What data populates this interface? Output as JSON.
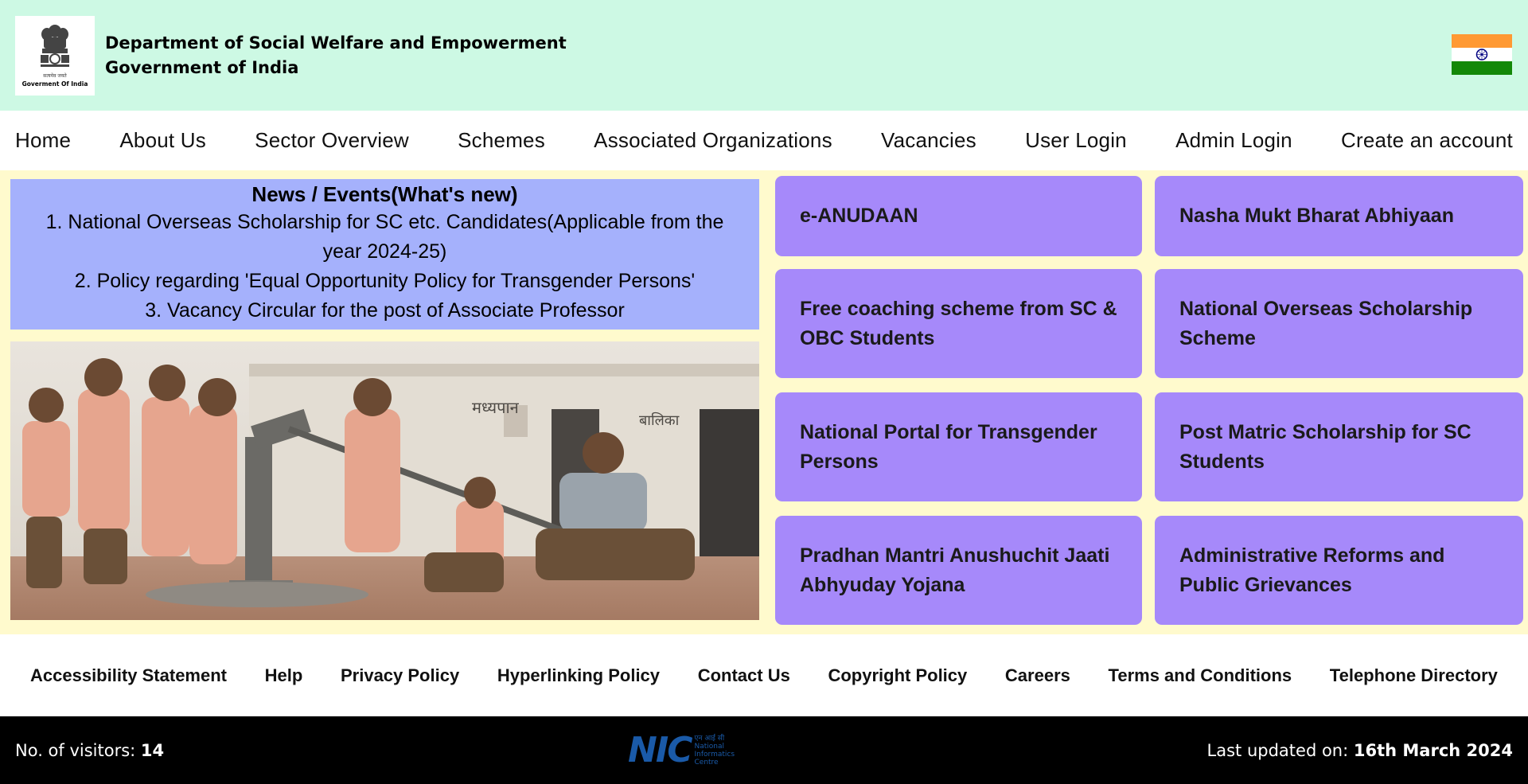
{
  "header": {
    "emblem_motto": "सत्यमेव जयते",
    "emblem_caption": "Goverment Of India",
    "department": "Department of Social Welfare and Empowerment",
    "government": "Government of India",
    "flag_colors": [
      "#ff9933",
      "#ffffff",
      "#138808"
    ]
  },
  "nav": {
    "items": [
      "Home",
      "About Us",
      "Sector Overview",
      "Schemes",
      "Associated Organizations",
      "Vacancies",
      "User Login",
      "Admin Login",
      "Create an account"
    ]
  },
  "news": {
    "title": "News / Events(What's new)",
    "items": [
      "1. National Overseas Scholarship for SC etc. Candidates(Applicable from the year 2024-25)",
      "2. Policy regarding 'Equal Opportunity Policy for Transgender Persons'",
      "3. Vacancy Circular for the post of Associate Professor"
    ]
  },
  "photo": {
    "wall_sign_left": "मध्यपान",
    "wall_sign_right": "बालिका"
  },
  "tiles": [
    "e-ANUDAAN",
    "Nasha Mukt Bharat Abhiyaan",
    "Free coaching scheme from SC & OBC Students",
    "National Overseas Scholarship Scheme",
    "National Portal for Transgender Persons",
    "Post Matric Scholarship for SC Students",
    "Pradhan Mantri Anushuchit Jaati Abhyuday Yojana",
    "Administrative Reforms and Public Grievances"
  ],
  "footer_links": [
    "Accessibility Statement",
    "Help",
    "Privacy Policy",
    "Hyperlinking Policy",
    "Contact Us",
    "Copyright Policy",
    "Careers",
    "Terms and Conditions",
    "Telephone Directory"
  ],
  "bottom": {
    "visitors_label": "No. of visitors:",
    "visitors_count": "14",
    "nic_logo": "NIC",
    "nic_hindi": "एन आई सी",
    "nic_caption_1": "National",
    "nic_caption_2": "Informatics",
    "nic_caption_3": "Centre",
    "updated_label": "Last updated on:",
    "updated_date": "16th March 2024"
  },
  "colors": {
    "header_bg": "#cdf9e4",
    "main_bg": "#fffacd",
    "news_bg": "#a5b1fc",
    "tile_bg": "#a689fa",
    "bottom_bg": "#000000"
  }
}
